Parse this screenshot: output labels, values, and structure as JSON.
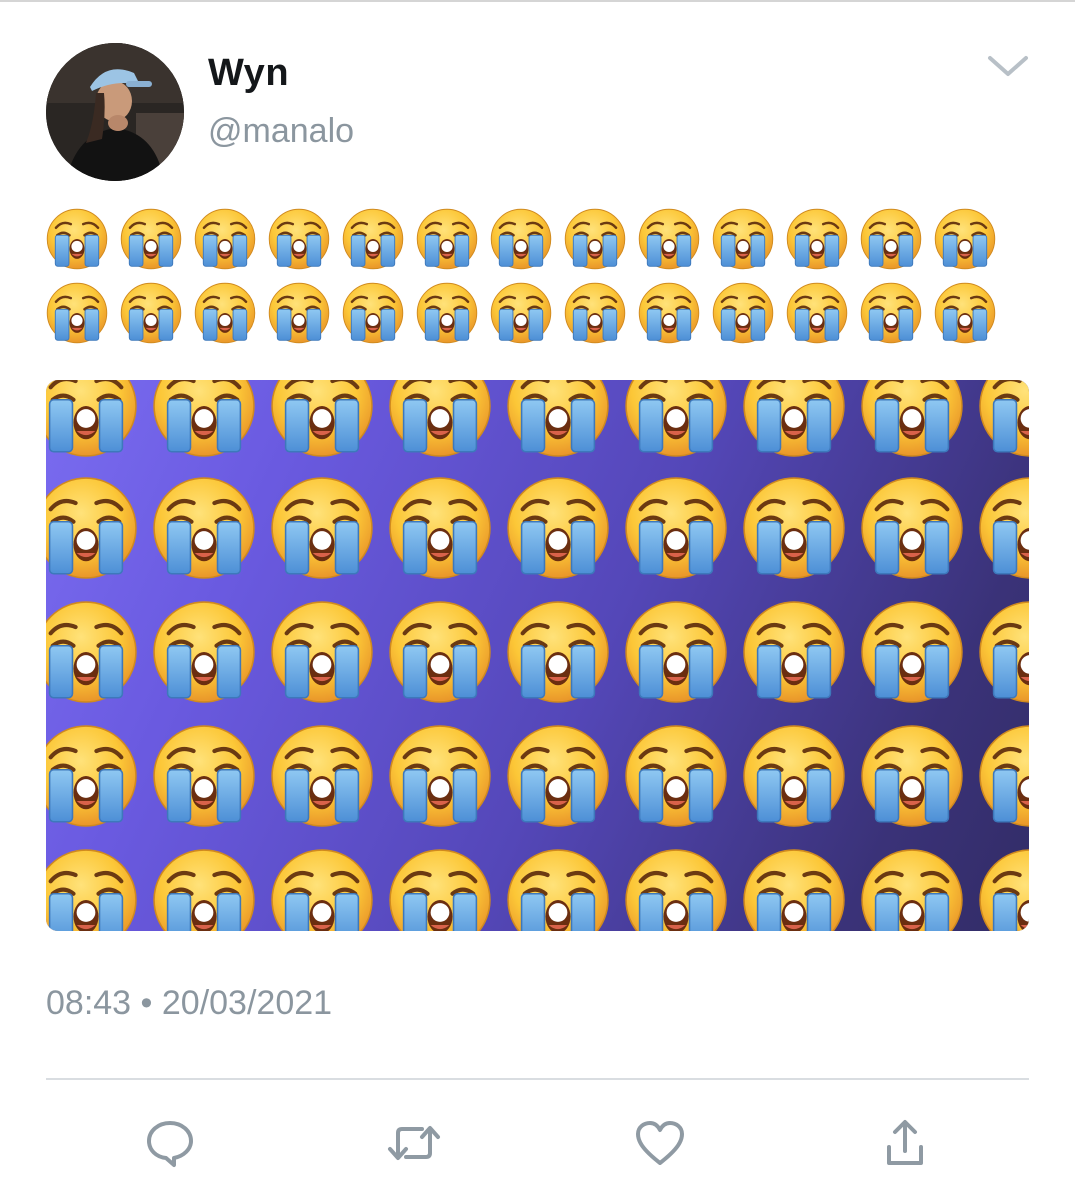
{
  "tweet": {
    "display_name": "Wyn",
    "handle": "@manalo",
    "text_emoji_rows": [
      [
        "😭",
        "😭",
        "😭",
        "😭",
        "😭",
        "😭",
        "😭",
        "😭",
        "😭",
        "😭",
        "😭",
        "😭",
        "😭"
      ],
      [
        "😭",
        "😭",
        "😭",
        "😭",
        "😭",
        "😭",
        "😭",
        "😭",
        "😭",
        "😭",
        "😭",
        "😭",
        "😭"
      ]
    ],
    "timestamp": "08:43 • 20/03/2021",
    "media_emoji": "😭",
    "menu_icon": "chevron-down-icon"
  },
  "actions": [
    {
      "name": "reply",
      "icon": "reply-icon"
    },
    {
      "name": "retweet",
      "icon": "retweet-icon"
    },
    {
      "name": "like",
      "icon": "heart-icon"
    },
    {
      "name": "share",
      "icon": "share-icon"
    }
  ],
  "colors": {
    "text": "#14171a",
    "secondary": "#8b969f",
    "icon": "#8f9aa3",
    "divider": "#d9dde1",
    "media_bg_light": "#7a6cf0",
    "media_bg_dark": "#322c66"
  }
}
